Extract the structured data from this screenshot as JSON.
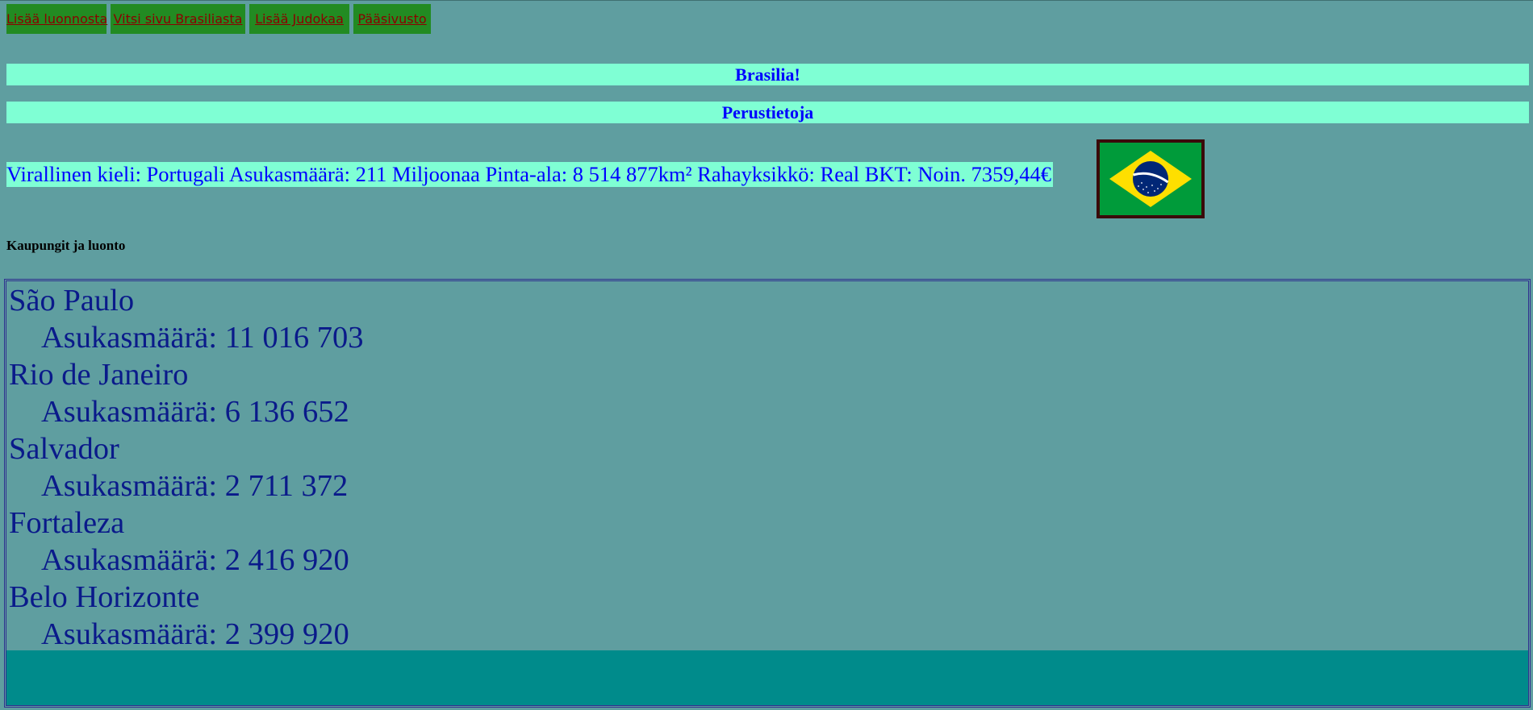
{
  "nav": {
    "links": [
      "Lisää luonnosta",
      "Vitsi sivu Brasiliasta",
      "Lisää Judokaa",
      "Pääsivusto"
    ]
  },
  "heading": {
    "title": "Brasilia!",
    "subtitle": "Perustietoja"
  },
  "facts": {
    "text": "Virallinen kieli: Portugali Asukasmäärä: 211 Miljoonaa Pinta-ala: 8 514 877km² Rahayksikkö: Real BKT: Noin. 7359,44€"
  },
  "section": {
    "title": "Kaupungit ja luonto"
  },
  "cities": [
    {
      "name": "São Paulo",
      "population": "Asukasmäärä: 11 016 703"
    },
    {
      "name": "Rio de Janeiro",
      "population": "Asukasmäärä: 6 136 652"
    },
    {
      "name": "Salvador",
      "population": "Asukasmäärä: 2 711 372"
    },
    {
      "name": "Fortaleza",
      "population": "Asukasmäärä: 2 416 920"
    },
    {
      "name": "Belo Horizonte",
      "population": "Asukasmäärä: 2 399 920"
    }
  ],
  "colors": {
    "page_background": "#5f9ea0",
    "nav_background": "#228b22",
    "nav_text": "#8b0000",
    "heading_background": "#7fffd4",
    "heading_text": "#0000ff",
    "city_text": "#0a1a8a",
    "frame_fill": "#008b8b"
  },
  "icons": {
    "flag": "brazil-flag-icon"
  }
}
